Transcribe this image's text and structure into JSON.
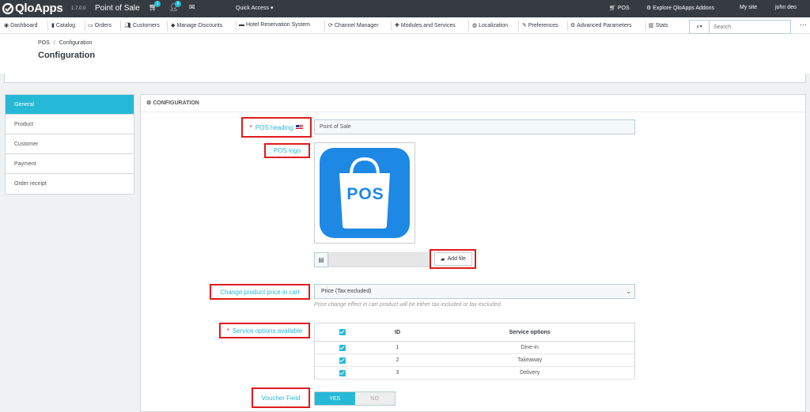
{
  "topbar": {
    "logo_text": "QloApps",
    "version": "1.7.0.0",
    "shop_name": "Point of Sale",
    "orders_badge": "1",
    "customers_badge": "5",
    "quick_access": "Quick Access ▾",
    "pos_link": "POS",
    "addons_link": "Explore QloApps Addons",
    "my_site": "My site",
    "user": "john deo"
  },
  "nav": {
    "items": [
      {
        "icon": "dashboard-icon",
        "label": "Dashboard"
      },
      {
        "icon": "catalog-icon",
        "label": "Catalog"
      },
      {
        "icon": "orders-icon",
        "label": "Orders"
      },
      {
        "icon": "customers-icon",
        "label": "Customers"
      },
      {
        "icon": "discounts-icon",
        "label": "Manage Discounts"
      },
      {
        "icon": "bed-icon",
        "label": "Hotel Reservation System"
      },
      {
        "icon": "sync-icon",
        "label": "Channel Manager"
      },
      {
        "icon": "puzzle-icon",
        "label": "Modules and Services"
      },
      {
        "icon": "globe-icon",
        "label": "Localization"
      },
      {
        "icon": "wrench-icon",
        "label": "Preferences"
      },
      {
        "icon": "cogs-icon",
        "label": "Advanced Parameters"
      },
      {
        "icon": "chart-icon",
        "label": "Stats"
      }
    ],
    "search_placeholder": "Search"
  },
  "header": {
    "breadcrumb_parent": "POS",
    "breadcrumb_current": "Configuration",
    "title": "Configuration"
  },
  "tabs": [
    "General",
    "Product",
    "Customer",
    "Payment",
    "Order receipt"
  ],
  "panel": {
    "heading": "CONFIGURATION",
    "pos_heading_label": "POS heading",
    "pos_heading_value": "Point of Sale",
    "pos_logo_label": "POS logo",
    "logo_text": "POS",
    "add_file": "Add file",
    "price_label": "Change product price in cart",
    "price_value": "Price (Tax excluded)",
    "price_help": "Price change effect in cart product will be either tax included or tax excluded.",
    "service_label": "Service options available",
    "service_table": {
      "col_id": "ID",
      "col_name": "Service options",
      "rows": [
        {
          "id": "1",
          "name": "Dine-in"
        },
        {
          "id": "2",
          "name": "Takeaway"
        },
        {
          "id": "3",
          "name": "Delivery"
        }
      ]
    },
    "voucher_label": "Voucher Field",
    "toggle_yes": "YES",
    "toggle_no": "NO"
  },
  "colors": {
    "topbar": "#363a41",
    "accent": "#25b9d7",
    "highlight": "#e01b1b",
    "logo_blue": "#1e88e5"
  }
}
